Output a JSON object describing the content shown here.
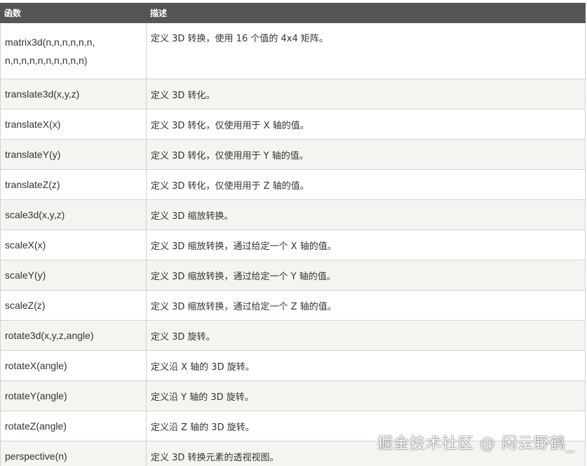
{
  "table": {
    "headers": [
      "函数",
      "描述"
    ],
    "rows": [
      {
        "func_line1": "matrix3d(n,n,n,n,n,n,",
        "func_line2": "n,n,n,n,n,n,n,n,n,n)",
        "desc": "定义 3D 转换，使用 16 个值的 4x4 矩阵。"
      },
      {
        "func": "translate3d(x,y,z)",
        "desc": "定义 3D 转化。"
      },
      {
        "func": "translateX(x)",
        "desc": "定义 3D 转化，仅使用用于 X 轴的值。"
      },
      {
        "func": "translateY(y)",
        "desc": "定义 3D 转化，仅使用用于 Y 轴的值。"
      },
      {
        "func": "translateZ(z)",
        "desc": "定义 3D 转化，仅使用用于 Z 轴的值。"
      },
      {
        "func": "scale3d(x,y,z)",
        "desc": "定义 3D 缩放转换。"
      },
      {
        "func": "scaleX(x)",
        "desc": "定义 3D 缩放转换，通过给定一个 X 轴的值。"
      },
      {
        "func": "scaleY(y)",
        "desc": "定义 3D 缩放转换，通过给定一个 Y 轴的值。"
      },
      {
        "func": "scaleZ(z)",
        "desc": "定义 3D 缩放转换，通过给定一个 Z 轴的值。"
      },
      {
        "func": "rotate3d(x,y,z,angle)",
        "desc": "定义 3D 旋转。"
      },
      {
        "func": "rotateX(angle)",
        "desc": "定义沿 X 轴的 3D 旋转。"
      },
      {
        "func": "rotateY(angle)",
        "desc": "定义沿 Y 轴的 3D 旋转。"
      },
      {
        "func": "rotateZ(angle)",
        "desc": "定义沿 Z 轴的 3D 旋转。"
      },
      {
        "func": "perspective(n)",
        "desc": "定义 3D 转换元素的透视视图。"
      }
    ]
  },
  "watermark": "掘金技术社区 @ 闲云野鹤_",
  "colors": {
    "header_bg": "#555555",
    "header_text": "#ffffff",
    "row_alt_bg": "#f6f4f0",
    "border": "#d4d4d4",
    "text": "#333333"
  }
}
